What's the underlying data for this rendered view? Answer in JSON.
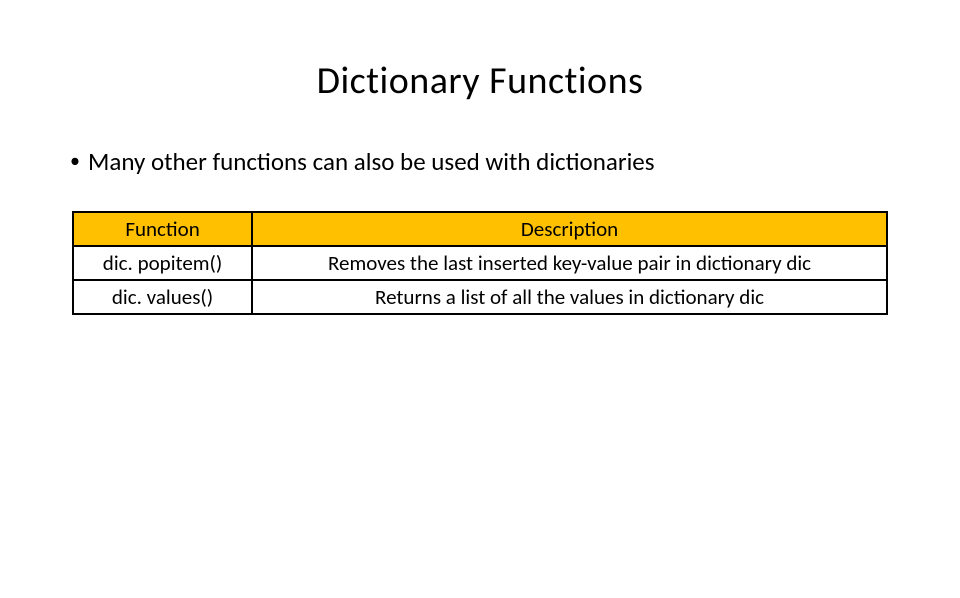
{
  "title": "Dictionary Functions",
  "bullet": "Many other functions can also be used with dictionaries",
  "table": {
    "headers": {
      "function": "Function",
      "description": "Description"
    },
    "rows": [
      {
        "function": "dic. popitem()",
        "description": "Removes the last inserted key-value pair in dictionary dic"
      },
      {
        "function": "dic. values()",
        "description": "Returns a list of all the values in dictionary dic"
      }
    ]
  },
  "colors": {
    "header_bg": "#ffc000",
    "border": "#000000",
    "text": "#000000",
    "background": "#ffffff"
  }
}
